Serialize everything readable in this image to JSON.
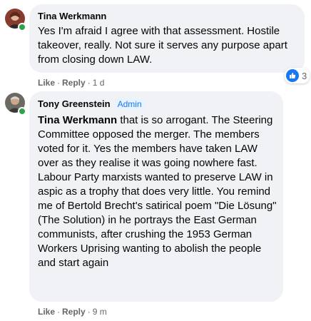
{
  "comments": [
    {
      "author": "Tina Werkmann",
      "text": "Yes I'm afraid I agree with that assessment. Hostile takeover, really. Not sure it serves any purpose apart from closing down LAW.",
      "actions": {
        "like": "Like",
        "reply": "Reply",
        "time": "1 d"
      },
      "reactions": {
        "icon": "like-icon",
        "count": "3"
      }
    },
    {
      "author": "Tony Greenstein",
      "badge": "Admin",
      "mention": "Tina Werkmann",
      "text": " that is so arrogant. The Steering Committee opposed the merger. The members voted for it. Yes the members have taken LAW over as they realise it was going nowhere fast. Labour Party marxists wanted to preserve LAW in aspic as a trophy that does very little. You remind me of Bertold Brecht's satirical poem \"Die Lösung\" (The Solution) in he portrays the East German communists, after crushing the 1953 German Workers Uprising wanting to abolish the people and start again",
      "actions": {
        "like": "Like",
        "reply": "Reply",
        "time": "9 m"
      }
    }
  ],
  "colors": {
    "bubble": "#f0f2f5",
    "link": "#1877f2",
    "online": "#31a24c",
    "meta": "#65676b"
  }
}
